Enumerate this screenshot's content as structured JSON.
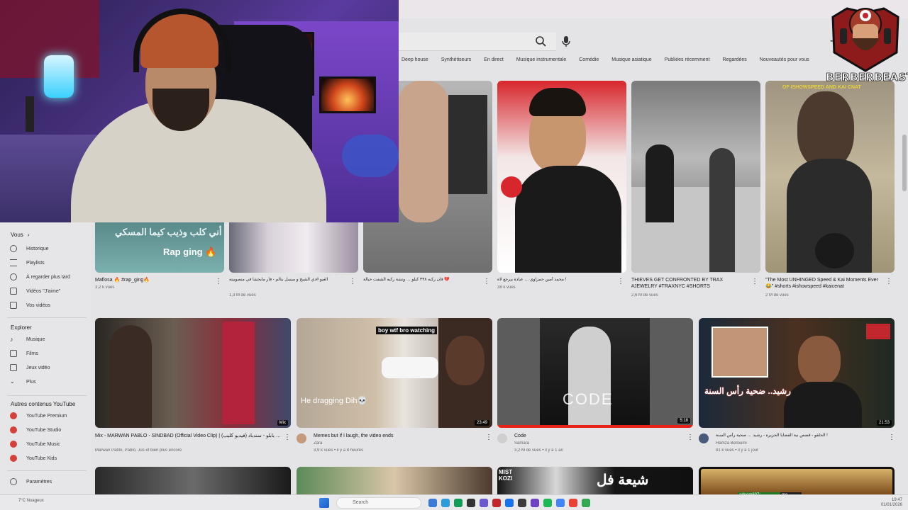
{
  "chips": [
    "Deep house",
    "Synthétiseurs",
    "En direct",
    "Musique instrumentale",
    "Comédie",
    "Musique asiatique",
    "Publiées récemment",
    "Regardées",
    "Nouveautés pour vous"
  ],
  "logo": {
    "text": "BERBERBEAST"
  },
  "overlay_text": {
    "thumb4_top": "OF ISHOWSPEED AND KAI CNAT"
  },
  "sidebar": {
    "vous": "Vous",
    "vous_items": [
      "Historique",
      "Playlists",
      "À regarder plus tard",
      "Vidéos \"J'aime\"",
      "Vos vidéos"
    ],
    "explorer": "Explorer",
    "explorer_items": [
      "Musique",
      "Films",
      "Jeux vidéo",
      "Plus"
    ],
    "autres": "Autres contenus YouTube",
    "autres_items": [
      "YouTube Premium",
      "YouTube Studio",
      "YouTube Music",
      "YouTube Kids"
    ],
    "parametres": "Paramètres"
  },
  "row1": [
    {
      "title": "Mafiosa 🔥 #rap_ging🔥",
      "meta1": "3,2 k vues",
      "caption": "Rap ging 🔥",
      "caption_ar": "أني كلب وذيب كيما المسكي"
    },
    {
      "title": "العيو #دي الشيخ و ميسل بتالم - فار مايحشا في منصوبيته",
      "meta1": "1,3 M de vues"
    },
    {
      "title": "قان ركبه ٣٣٨ كيلو … ونشة ركبه الشفت حيالة 💔",
      "meta1": ""
    },
    {
      "title": "محمد أمين حمزاوي … عيادة يبرجع لاة !",
      "meta1": "38 k vues"
    },
    {
      "title": "THIEVES GET CONFRONTED BY TRAX #JEWELRY #TRAXNYC #SHORTS",
      "meta1": "2,6 M de vues"
    },
    {
      "title": "\"The Most UNHINGED Speed & Kai Moments Ever 😂\" #shorts #ishowspeed #kaicenat",
      "meta1": "2 M de vues"
    }
  ],
  "row2": [
    {
      "title": "Mix - MARWAN PABLO - SINDBAD (Official Video Clip) | مروان بابلو - سندباد (فيديو كليب)",
      "channel": "Marwan Pablo, Pablo, Jus et bien plus encore",
      "meta": "",
      "duration": "Mix"
    },
    {
      "title": "Memes but if I laugh, the video ends",
      "channel": "Zara",
      "meta": "3,9 k vues • il y a 8 heures",
      "duration": "23:49",
      "caption_top": "boy wtf bro watching",
      "caption_bottom": "He dragging Dih💀"
    },
    {
      "title": "Code",
      "channel": "Samara",
      "meta": "3,2 M de vues • il y a 1 an",
      "duration": "5:18",
      "caption": "CODE"
    },
    {
      "title": "الحلقو - قصص نية القضايا الجزيرة - رشيد … صحية رأس السنة !",
      "channel": "Hamza Belloumi",
      "meta": "81 k vues • il y a 1 jour",
      "duration": "21:53",
      "caption": "رشيد.. ضحية رأس السنة"
    }
  ],
  "row3": [
    {
      "caption": ""
    },
    {
      "caption": ""
    },
    {
      "caption": "MIST KOZI"
    },
    {
      "caption": "شيعة فل"
    }
  ],
  "taskbar": {
    "search": "Search",
    "weather": "7°C",
    "weather_sub": "Nuageux",
    "time": "19:47",
    "date": "01/01/2026"
  },
  "chat": {
    "user": "adeem607:",
    "msg": "mo"
  }
}
